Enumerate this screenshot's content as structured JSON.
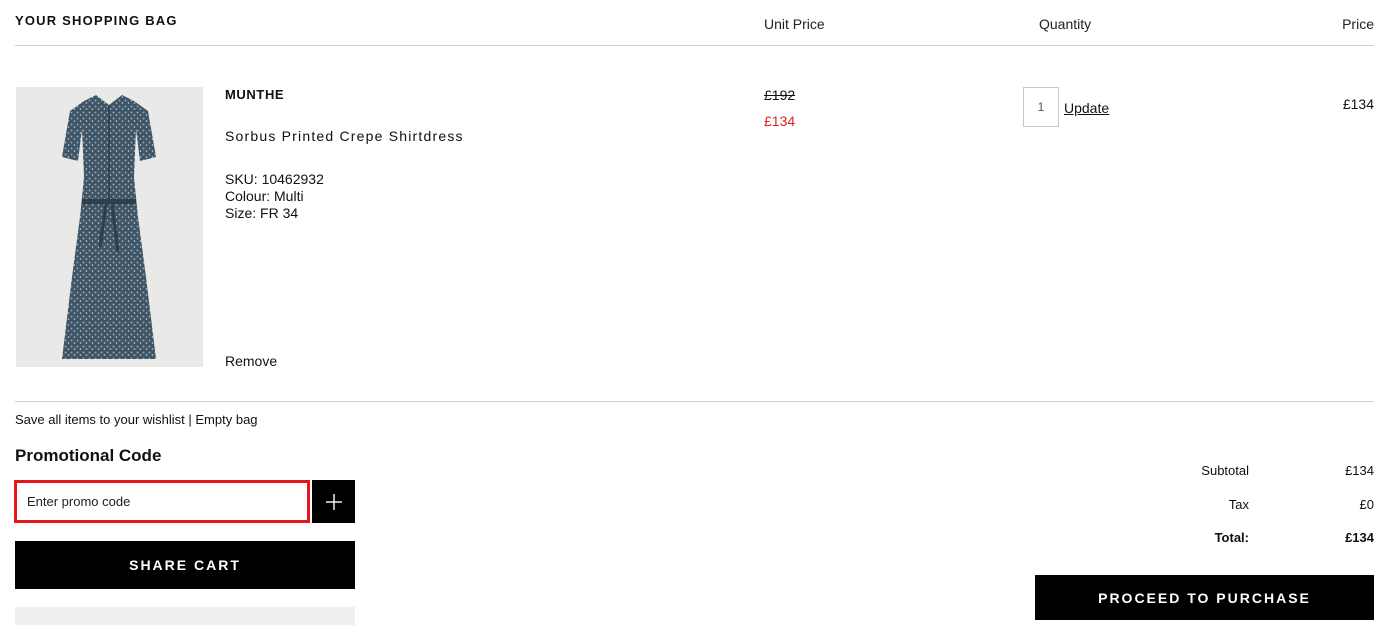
{
  "header": {
    "bag_title": "YOUR SHOPPING BAG",
    "col_unit_price": "Unit Price",
    "col_quantity": "Quantity",
    "col_price": "Price"
  },
  "item": {
    "image_icon": "dress-product-image",
    "brand": "MUNTHE",
    "name": "Sorbus Printed Crepe Shirtdress",
    "sku": "SKU: 10462932",
    "colour": "Colour: Multi",
    "size": "Size: FR 34",
    "remove_label": "Remove",
    "original_price": "£192",
    "sale_price": "£134",
    "quantity": "1",
    "update_label": "Update",
    "line_price": "£134"
  },
  "bag_actions": {
    "save_wishlist": "Save all items to your wishlist",
    "separator": " | ",
    "empty_bag": "Empty bag"
  },
  "promo": {
    "title": "Promotional Code",
    "placeholder": "Enter promo code",
    "add_icon": "plus-icon"
  },
  "share_cart_label": "SHARE CART",
  "totals": {
    "subtotal_label": "Subtotal",
    "subtotal_value": "£134",
    "tax_label": "Tax",
    "tax_value": "£0",
    "total_label": "Total:",
    "total_value": "£134"
  },
  "proceed_label": "PROCEED TO PURCHASE",
  "colors": {
    "sale_red": "#e02020",
    "highlight_border": "#e8141b",
    "button_black": "#000000"
  }
}
